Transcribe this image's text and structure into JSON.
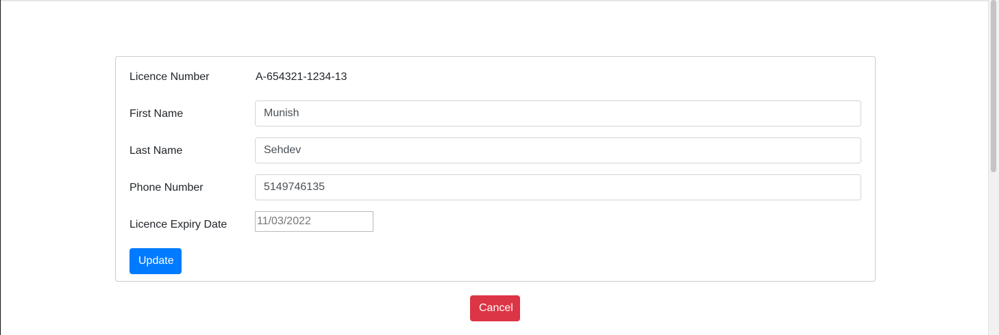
{
  "form": {
    "licence_number": {
      "label": "Licence Number",
      "value": "A-654321-1234-13"
    },
    "first_name": {
      "label": "First Name",
      "value": "Munish"
    },
    "last_name": {
      "label": "Last Name",
      "value": "Sehdev"
    },
    "phone_number": {
      "label": "Phone Number",
      "value": "5149746135"
    },
    "licence_expiry_date": {
      "label": "Licence Expiry Date",
      "value": "11/03/2022"
    },
    "update_label": "Update"
  },
  "actions": {
    "cancel_label": "Cancel"
  },
  "colors": {
    "primary": "#007bff",
    "danger": "#dc3545"
  }
}
